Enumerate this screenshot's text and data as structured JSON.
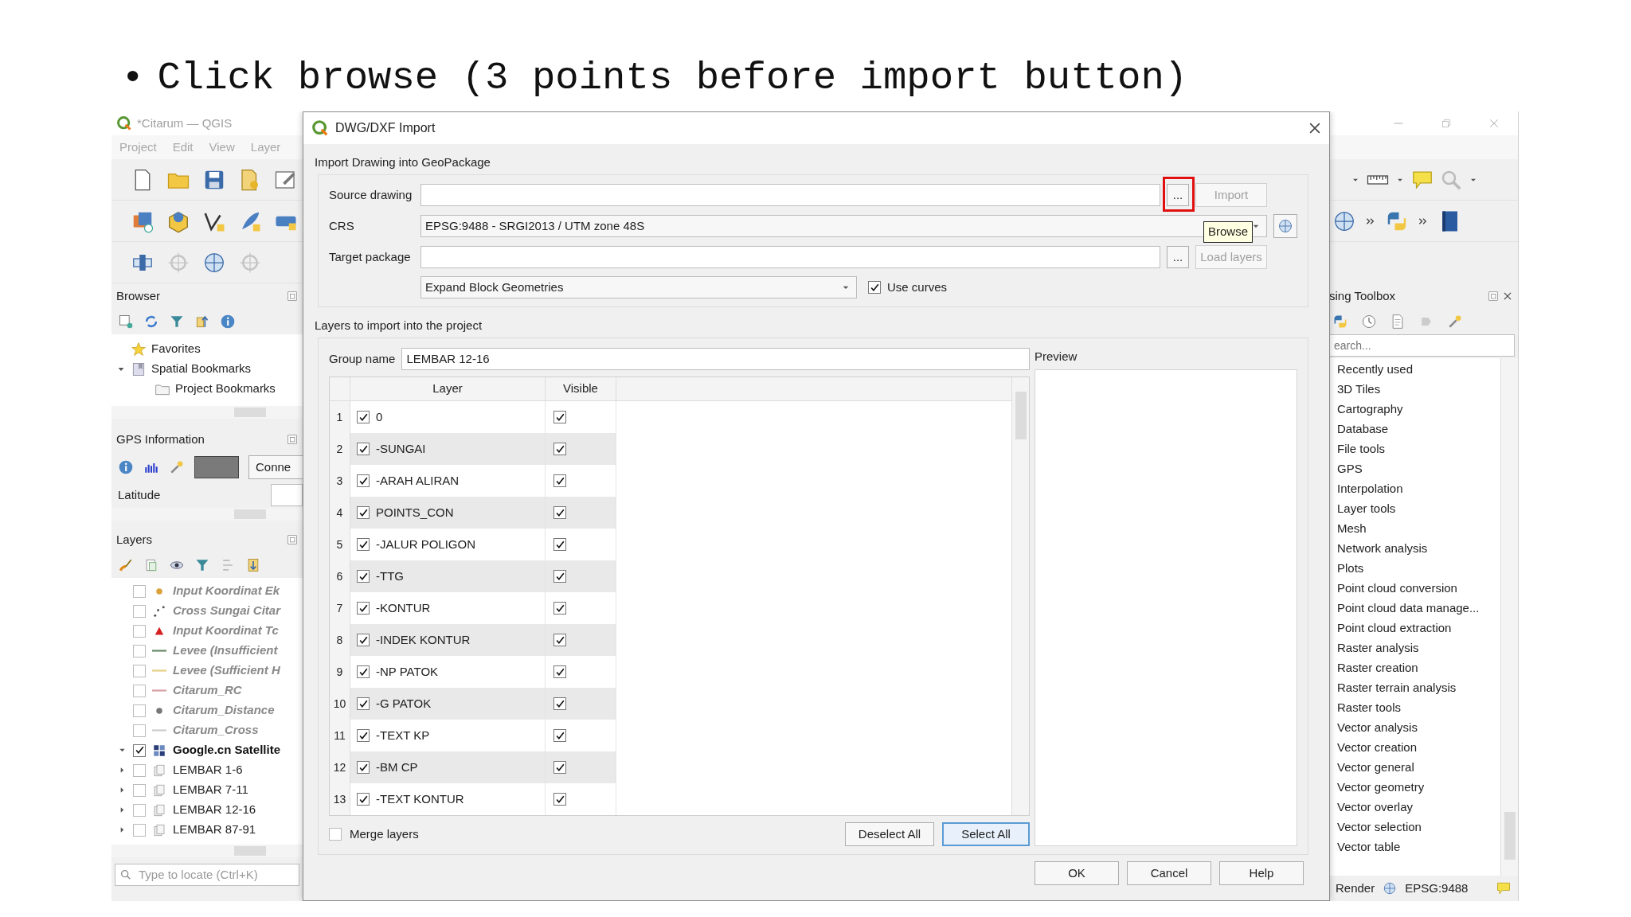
{
  "slide": {
    "bullet": "•",
    "heading": "Click browse (3 points before import button)"
  },
  "main_window": {
    "title": "*Citarum — QGIS",
    "menu": [
      "Project",
      "Edit",
      "View",
      "Layer"
    ],
    "browser": {
      "title": "Browser",
      "items": [
        {
          "label": "Favorites",
          "kind": "favorites"
        },
        {
          "label": "Spatial Bookmarks",
          "kind": "bookmarks",
          "expanded": true,
          "children": [
            {
              "label": "Project Bookmarks",
              "kind": "folder"
            }
          ]
        }
      ]
    },
    "gps": {
      "title": "GPS Information",
      "connect_button": "Conne",
      "latitude_label": "Latitude"
    },
    "layers": {
      "title": "Layers",
      "items": [
        {
          "label": "Input Koordinat Ek",
          "checked": false,
          "dimmed": true,
          "kind": "dot",
          "color": "#d9a23a"
        },
        {
          "label": "Cross Sungai Citar",
          "checked": false,
          "dimmed": true,
          "kind": "points",
          "color": "#555555"
        },
        {
          "label": "Input Koordinat Tc",
          "checked": false,
          "dimmed": true,
          "kind": "triangle",
          "color": "#d42020"
        },
        {
          "label": "Levee (Insufficient",
          "checked": false,
          "dimmed": true,
          "kind": "line",
          "color": "#6b8e6b"
        },
        {
          "label": "Levee (Sufficient H",
          "checked": false,
          "dimmed": true,
          "kind": "line",
          "color": "#e8d08a"
        },
        {
          "label": "Citarum_RC",
          "checked": false,
          "dimmed": true,
          "kind": "line",
          "color": "#d8a0a8"
        },
        {
          "label": "Citarum_Distance",
          "checked": false,
          "dimmed": true,
          "kind": "dot",
          "color": "#777777"
        },
        {
          "label": "Citarum_Cross",
          "checked": false,
          "dimmed": true,
          "kind": "line",
          "color": "#cccccc"
        },
        {
          "label": "Google.cn Satellite",
          "checked": true,
          "current": true,
          "expanded": true,
          "kind": "raster"
        },
        {
          "label": "LEMBAR 1-6",
          "checked": false,
          "expanded": false,
          "kind": "group"
        },
        {
          "label": "LEMBAR 7-11",
          "checked": false,
          "expanded": false,
          "kind": "group"
        },
        {
          "label": "LEMBAR 12-16",
          "checked": false,
          "expanded": false,
          "kind": "group"
        },
        {
          "label": "LEMBAR 87-91",
          "checked": false,
          "expanded": false,
          "kind": "group"
        }
      ],
      "locate_placeholder": "Type to locate (Ctrl+K)"
    },
    "toolbox": {
      "title": "sing Toolbox",
      "search_placeholder": "earch...",
      "items": [
        "Recently used",
        "3D Tiles",
        "Cartography",
        "Database",
        "File tools",
        "GPS",
        "Interpolation",
        "Layer tools",
        "Mesh",
        "Network analysis",
        "Plots",
        "Point cloud conversion",
        "Point cloud data manage...",
        "Point cloud extraction",
        "Raster analysis",
        "Raster creation",
        "Raster terrain analysis",
        "Raster tools",
        "Vector analysis",
        "Vector creation",
        "Vector general",
        "Vector geometry",
        "Vector overlay",
        "Vector selection",
        "Vector table"
      ]
    },
    "status_bar": {
      "render": "Render",
      "crs": "EPSG:9488"
    }
  },
  "dialog": {
    "title": "DWG/DXF Import",
    "section_1": "Import Drawing into GeoPackage",
    "source_label": "Source drawing",
    "source_browse": {
      "label": "...",
      "highlighted": true
    },
    "import_button": {
      "label": "Import",
      "disabled": true
    },
    "crs_label": "CRS",
    "crs_value": "EPSG:9488 - SRGI2013 / UTM zone 48S",
    "tooltip": "Browse",
    "target_label": "Target package",
    "target_browse": {
      "label": "..."
    },
    "load_button": {
      "label": "Load layers",
      "disabled": true
    },
    "block_mode": "Expand Block Geometries",
    "use_curves": {
      "label": "Use curves",
      "checked": true
    },
    "section_2": "Layers to import into the project",
    "group_label": "Group name",
    "group_value": "LEMBAR 12-16",
    "preview_label": "Preview",
    "columns": [
      "Layer",
      "Visible"
    ],
    "rows": [
      {
        "number": "1",
        "layer": "0",
        "checked": true,
        "visible": true
      },
      {
        "number": "2",
        "layer": "-SUNGAI",
        "checked": true,
        "visible": true
      },
      {
        "number": "3",
        "layer": "-ARAH ALIRAN",
        "checked": true,
        "visible": true
      },
      {
        "number": "4",
        "layer": "POINTS_CON",
        "checked": true,
        "visible": true
      },
      {
        "number": "5",
        "layer": "-JALUR POLIGON",
        "checked": true,
        "visible": true
      },
      {
        "number": "6",
        "layer": "-TTG",
        "checked": true,
        "visible": true
      },
      {
        "number": "7",
        "layer": "-KONTUR",
        "checked": true,
        "visible": true
      },
      {
        "number": "8",
        "layer": "-INDEK KONTUR",
        "checked": true,
        "visible": true
      },
      {
        "number": "9",
        "layer": "-NP PATOK",
        "checked": true,
        "visible": true
      },
      {
        "number": "10",
        "layer": "-G PATOK",
        "checked": true,
        "visible": true
      },
      {
        "number": "11",
        "layer": "-TEXT KP",
        "checked": true,
        "visible": true
      },
      {
        "number": "12",
        "layer": "-BM CP",
        "checked": true,
        "visible": true
      },
      {
        "number": "13",
        "layer": "-TEXT KONTUR",
        "checked": true,
        "visible": true
      }
    ],
    "merge_layers": {
      "label": "Merge layers",
      "checked": false
    },
    "deselect_button": "Deselect All",
    "select_button": "Select All",
    "buttons": [
      "OK",
      "Cancel",
      "Help"
    ]
  }
}
